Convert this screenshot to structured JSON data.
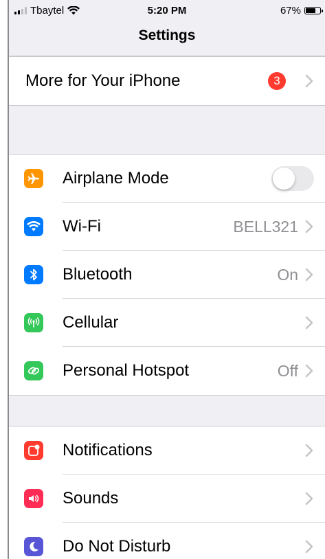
{
  "status_bar": {
    "carrier": "Tbaytel",
    "time": "5:20 PM",
    "battery": "67%",
    "battery_level": 0.67
  },
  "nav": {
    "title": "Settings"
  },
  "promo": {
    "label": "More for Your iPhone",
    "badge": "3"
  },
  "group1": {
    "airplane": {
      "label": "Airplane Mode",
      "icon": "airplane-icon",
      "color": "#ff9500",
      "on": false
    },
    "wifi": {
      "label": "Wi-Fi",
      "value": "BELL321",
      "icon": "wifi-icon",
      "color": "#007aff"
    },
    "bluetooth": {
      "label": "Bluetooth",
      "value": "On",
      "icon": "bluetooth-icon",
      "color": "#007aff"
    },
    "cellular": {
      "label": "Cellular",
      "icon": "cellular-antenna-icon",
      "color": "#34c759"
    },
    "hotspot": {
      "label": "Personal Hotspot",
      "value": "Off",
      "icon": "hotspot-link-icon",
      "color": "#34c759"
    }
  },
  "group2": {
    "notifications": {
      "label": "Notifications",
      "icon": "notifications-icon",
      "color": "#ff3b30"
    },
    "sounds": {
      "label": "Sounds",
      "icon": "speaker-icon",
      "color": "#ff2d55"
    },
    "dnd": {
      "label": "Do Not Disturb",
      "icon": "moon-icon",
      "color": "#5856d6"
    }
  }
}
